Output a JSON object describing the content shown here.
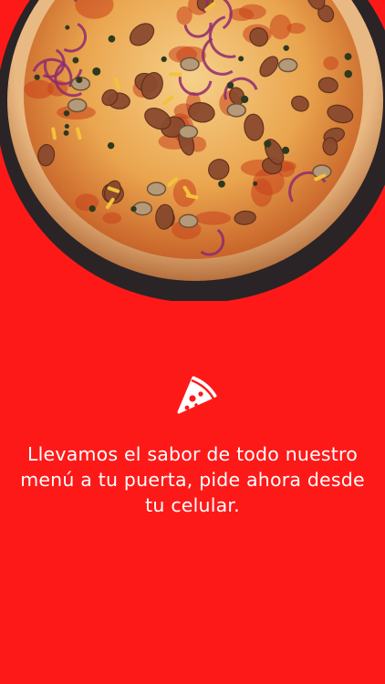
{
  "colors": {
    "background": "#FE1919",
    "text": "#FFFFFF",
    "pan": "#2A2426",
    "crust": "#E7B27A",
    "sauce": "#C9411C",
    "cheese": "#F3C169"
  },
  "hero": {
    "image": "pepperoni-pizza-photo"
  },
  "icons": {
    "badge": "pizza-slice-icon"
  },
  "content": {
    "tagline": "Llevamos el sabor de todo nuestro menú a tu puerta, pide ahora desde tu celular."
  }
}
